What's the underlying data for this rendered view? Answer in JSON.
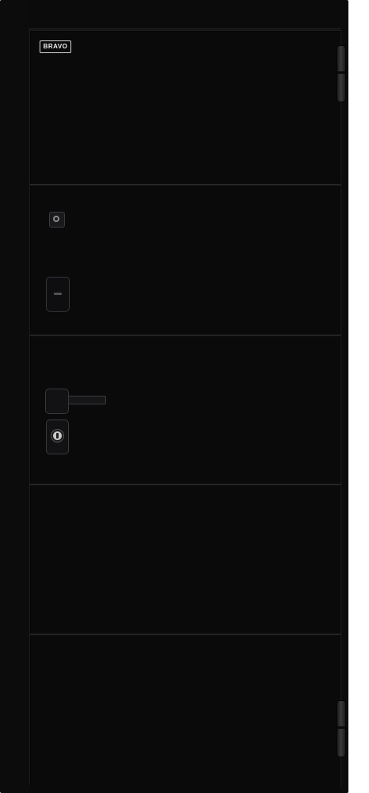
{
  "product": {
    "brand": "BRAVO",
    "door_color": "#0a0a0b",
    "frame_color": "#0c0c0d",
    "groove_count": 4,
    "hardware": {
      "handle_icon": "door-lever-handle-icon",
      "peephole_icon": "peephole-icon",
      "lock_icons": [
        "upper-lock-icon",
        "cylinder-lock-icon"
      ],
      "hinge_icons": [
        "hinge-top-icon",
        "hinge-bottom-icon"
      ]
    }
  }
}
